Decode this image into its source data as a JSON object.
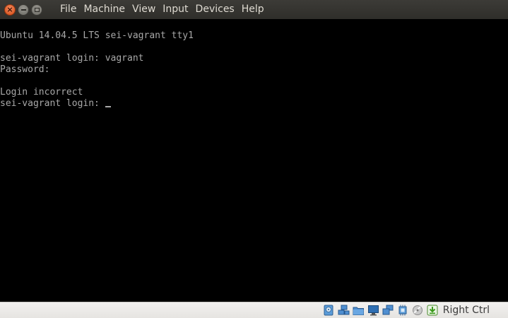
{
  "menubar": {
    "items": [
      {
        "label": "File"
      },
      {
        "label": "Machine"
      },
      {
        "label": "View"
      },
      {
        "label": "Input"
      },
      {
        "label": "Devices"
      },
      {
        "label": "Help"
      }
    ]
  },
  "console": {
    "lines": [
      "Ubuntu 14.04.5 LTS sei-vagrant tty1",
      "",
      "sei-vagrant login: vagrant",
      "Password:",
      "",
      "Login incorrect",
      "sei-vagrant login: "
    ]
  },
  "statusbar": {
    "icons": [
      "hard-disk-icon",
      "network-icon",
      "shared-folders-icon",
      "display-icon",
      "video-capture-icon",
      "usb-icon",
      "optical-drive-icon",
      "keyboard-capture-icon"
    ],
    "host_key": "Right Ctrl"
  },
  "colors": {
    "menubar_bg": "#3c3b37",
    "menu_text": "#dfdbd2",
    "console_bg": "#000000",
    "console_text": "#a8a8a8",
    "statusbar_bg": "#f2f1f0",
    "close_button": "#e05d24"
  }
}
